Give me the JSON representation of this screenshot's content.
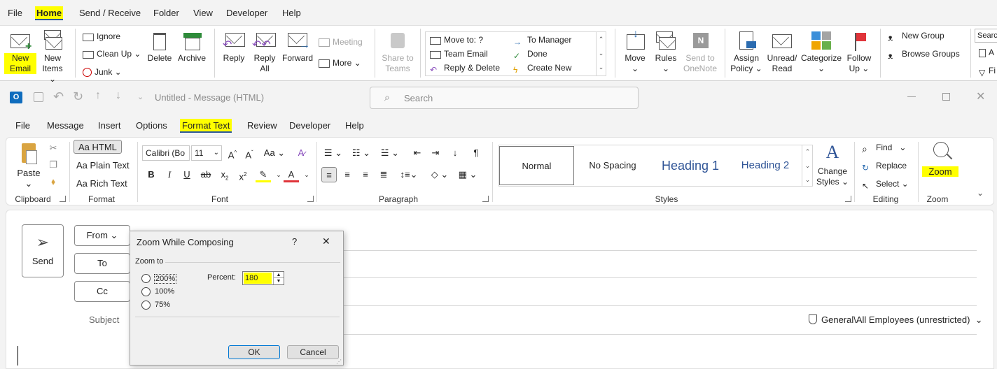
{
  "outer_tabs": [
    "File",
    "Home",
    "Send / Receive",
    "Folder",
    "View",
    "Developer",
    "Help"
  ],
  "outer_ribbon": {
    "new_email": [
      "New",
      "Email"
    ],
    "new_items": [
      "New",
      "Items ⌄"
    ],
    "ignore": "Ignore",
    "clean_up": "Clean Up ⌄",
    "junk": "Junk ⌄",
    "delete": "Delete",
    "archive": "Archive",
    "reply": "Reply",
    "reply_all": [
      "Reply",
      "All"
    ],
    "forward": "Forward",
    "meeting": "Meeting",
    "more": "More ⌄",
    "share_to_teams": [
      "Share to",
      "Teams"
    ],
    "quick_steps": [
      "Move to: ?",
      "Team Email",
      "Reply & Delete",
      "To Manager",
      "Done",
      "Create New"
    ],
    "move": "Move",
    "rules": "Rules",
    "send_to_onenote": [
      "Send to",
      "OneNote"
    ],
    "assign_policy": [
      "Assign",
      "Policy ⌄"
    ],
    "unread_read": [
      "Unread/",
      "Read"
    ],
    "categorize": "Categorize",
    "follow_up": [
      "Follow",
      "Up ⌄"
    ],
    "new_group": "New Group",
    "browse_groups": "Browse Groups",
    "search_people": "Searc",
    "address_book": "A",
    "filter": "Fi"
  },
  "message_window": {
    "title": "Untitled  -  Message (HTML)",
    "search_placeholder": "Search",
    "tabs": [
      "File",
      "Message",
      "Insert",
      "Options",
      "Format Text",
      "Review",
      "Developer",
      "Help"
    ],
    "clipboard": {
      "paste": "Paste",
      "label": "Clipboard"
    },
    "format": {
      "html": "Aa HTML",
      "plain": "Aa Plain Text",
      "rich": "Aa Rich Text",
      "label": "Format"
    },
    "font": {
      "name": "Calibri (Bo",
      "size": "11",
      "label": "Font"
    },
    "paragraph": {
      "label": "Paragraph"
    },
    "styles": {
      "items": [
        "Normal",
        "No Spacing",
        "Heading 1",
        "Heading 2"
      ],
      "change": [
        "Change",
        "Styles ⌄"
      ],
      "label": "Styles"
    },
    "editing": {
      "find": "Find",
      "replace": "Replace",
      "select": "Select ⌄",
      "label": "Editing"
    },
    "zoom": {
      "btn": "Zoom",
      "label": "Zoom"
    }
  },
  "compose": {
    "send": "Send",
    "from": "From ⌄",
    "to": "To",
    "cc": "Cc",
    "subject": "Subject",
    "sensitivity": "General\\All Employees (unrestricted)"
  },
  "dialog": {
    "title": "Zoom While Composing",
    "help": "?",
    "close": "✕",
    "zoom_to": "Zoom to",
    "options": [
      "200%",
      "100%",
      "75%"
    ],
    "percent_label": "Percent:",
    "percent_value": "180",
    "ok": "OK",
    "cancel": "Cancel"
  },
  "colors": {
    "accent_blue": "#2b579a",
    "highlight": "#ffff00",
    "heading_blue": "#2f5496"
  }
}
